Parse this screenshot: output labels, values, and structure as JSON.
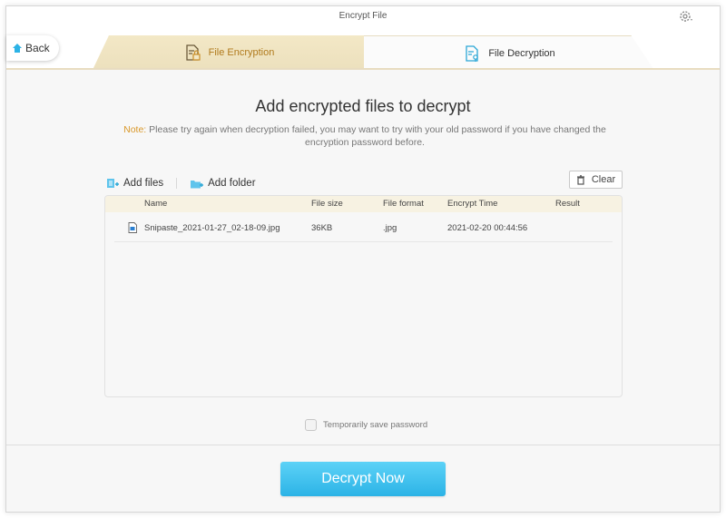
{
  "window": {
    "title": "Encrypt File"
  },
  "nav": {
    "back_label": "Back"
  },
  "tabs": [
    {
      "label": "File Encryption",
      "active": false
    },
    {
      "label": "File Decryption",
      "active": true
    }
  ],
  "main": {
    "heading": "Add encrypted files to decrypt",
    "note_label": "Note:",
    "note_text": " Please try again when decryption failed, you may want to try with your old password if you have changed the encryption password before."
  },
  "toolbar": {
    "add_files_label": "Add files",
    "add_folder_label": "Add folder",
    "clear_label": "Clear"
  },
  "table": {
    "columns": [
      "Name",
      "File size",
      "File format",
      "Encrypt Time",
      "Result"
    ],
    "rows": [
      {
        "name": "Snipaste_2021-01-27_02-18-09.jpg",
        "size": "36KB",
        "format": ".jpg",
        "time": "2021-02-20 00:44:56",
        "result": ""
      }
    ]
  },
  "options": {
    "save_password_label": "Temporarily save password",
    "save_password_checked": false
  },
  "actions": {
    "decrypt_label": "Decrypt Now"
  },
  "colors": {
    "accent_blue": "#2cb3e6",
    "encryption_tab_gold": "#b07a1c",
    "note_orange": "#d9982a"
  },
  "icons": {
    "settings": "gear-icon",
    "back": "home-arrow-icon",
    "file_encryption": "document-lock-icon",
    "file_decryption": "document-key-icon",
    "add_files": "files-icon",
    "add_folder": "folder-icon",
    "clear": "trash-icon",
    "file": "image-file-icon"
  }
}
